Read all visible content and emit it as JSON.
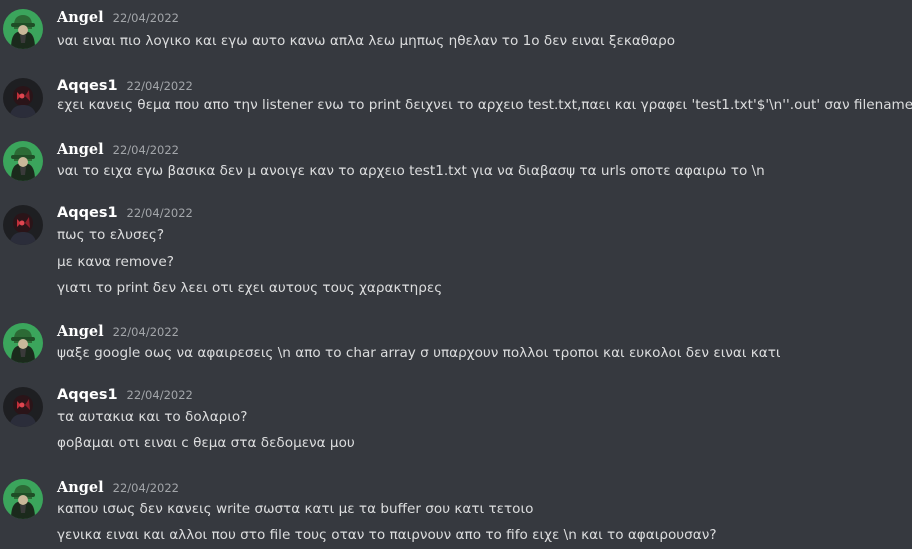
{
  "colors": {
    "background": "#36393f",
    "username": "#ffffff",
    "timestamp": "#a3a6aa",
    "message": "#dcddde",
    "angel_avatar_bg": "#3ba55c",
    "aqqes_avatar_bg": "#1e1f22"
  },
  "avatars": {
    "angel_icon": "green-hooded-figure-icon",
    "aqqes_icon": "dark-red-figure-icon"
  },
  "groups": [
    {
      "user": "Angel",
      "time": "22/04/2022",
      "messages": [
        "ναι ειναι πιο λογικο και εγω αυτο κανω απλα λεω μηπως ηθελαν το 1ο δεν ειναι ξεκαθαρο"
      ]
    },
    {
      "user": "Aqqes1",
      "time": "22/04/2022",
      "messages": [
        "εχει κανεις θεμα που απο την listener ενω το print δειχνει το αρχειο test.txt,παει και γραφει 'test1.txt'$'\\n''.out' σαν filename?"
      ]
    },
    {
      "user": "Angel",
      "time": "22/04/2022",
      "messages": [
        "ναι το ειχα εγω βασικα δεν μ ανοιγε καν το αρχειο test1.txt για να διαβασψ τα  urls οποτε αφαιρω το \\n"
      ]
    },
    {
      "user": "Aqqes1",
      "time": "22/04/2022",
      "messages": [
        "πως το ελυσες?",
        "με κανα remove?",
        "γιατι το print δεν λεει οτι εχει αυτους τους χαρακτηρες"
      ]
    },
    {
      "user": "Angel",
      "time": "22/04/2022",
      "messages": [
        "ψαξε google οως να αφαιρεσεις \\n απο το char array σ υπαρχουν πολλοι τροποι και ευκολοι δεν ειναι κατι"
      ]
    },
    {
      "user": "Aqqes1",
      "time": "22/04/2022",
      "messages": [
        "τα αυτακια και το δολαριο?",
        "φοβαμαι οτι ειναι c θεμα στα δεδομενα μου"
      ]
    },
    {
      "user": "Angel",
      "time": "22/04/2022",
      "messages": [
        "καπου ισως δεν κανεις write σωστα κατι με τα buffer σου κατι τετοιο",
        "γενικα ειναι και αλλοι που στο file τους οταν το παιρνουν απο το fifo ειχε \\n και το αφαιρουσαν?"
      ]
    }
  ]
}
